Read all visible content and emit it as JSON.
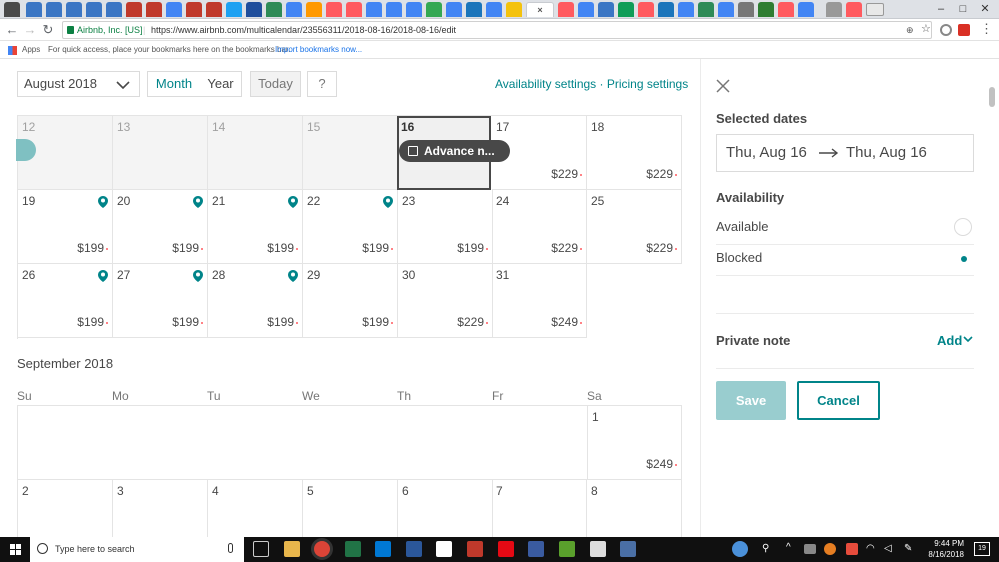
{
  "browser": {
    "url_host": "Airbnb, Inc. [US]",
    "url_path": "https://www.airbnb.com/multicalendar/23556311/2018-08-16/2018-08-16/edit",
    "bookmarks_apps": "Apps",
    "bookmarks_hint": "For quick access, place your bookmarks here on the bookmarks bar.",
    "bookmarks_import": "Import bookmarks now...",
    "tab_close": "×"
  },
  "toolbar": {
    "month_select": "August 2018",
    "view_month": "Month",
    "view_year": "Year",
    "today": "Today",
    "help": "?",
    "availability_link": "Availability settings",
    "separator": " · ",
    "pricing_link": "Pricing settings"
  },
  "calendar": {
    "week1": [
      {
        "day": "12",
        "price": ""
      },
      {
        "day": "13",
        "price": ""
      },
      {
        "day": "14",
        "price": ""
      },
      {
        "day": "15",
        "price": ""
      },
      {
        "day": "16",
        "price": ""
      },
      {
        "day": "17",
        "price": "$229"
      },
      {
        "day": "18",
        "price": "$229"
      }
    ],
    "week2": [
      {
        "day": "19",
        "price": "$199"
      },
      {
        "day": "20",
        "price": "$199"
      },
      {
        "day": "21",
        "price": "$199"
      },
      {
        "day": "22",
        "price": "$199"
      },
      {
        "day": "23",
        "price": "$199"
      },
      {
        "day": "24",
        "price": "$229"
      },
      {
        "day": "25",
        "price": "$229"
      }
    ],
    "week3": [
      {
        "day": "26",
        "price": "$199"
      },
      {
        "day": "27",
        "price": "$199"
      },
      {
        "day": "28",
        "price": "$199"
      },
      {
        "day": "29",
        "price": "$199"
      },
      {
        "day": "30",
        "price": "$229"
      },
      {
        "day": "31",
        "price": "$249"
      }
    ],
    "event_label": "Advance n...",
    "sept_title": "September 2018",
    "weekdays": [
      "Su",
      "Mo",
      "Tu",
      "We",
      "Th",
      "Fr",
      "Sa"
    ],
    "sept_week1": [
      {
        "day": "1",
        "price": "$249"
      }
    ],
    "sept_week2": [
      "2",
      "3",
      "4",
      "5",
      "6",
      "7",
      "8"
    ]
  },
  "panel": {
    "selected_dates_label": "Selected dates",
    "start_date": "Thu, Aug 16",
    "end_date": "Thu, Aug 16",
    "availability_label": "Availability",
    "option_available": "Available",
    "option_blocked": "Blocked",
    "private_note_label": "Private note",
    "add_label": "Add",
    "save_label": "Save",
    "cancel_label": "Cancel"
  },
  "taskbar": {
    "search_placeholder": "Type here to search",
    "time": "9:44 PM",
    "date": "8/16/2018",
    "notif_count": "19"
  },
  "colors": {
    "teal": "#008489",
    "teal_light": "#99cdcf",
    "event_dark": "#484848",
    "selected_border": "#484848"
  }
}
